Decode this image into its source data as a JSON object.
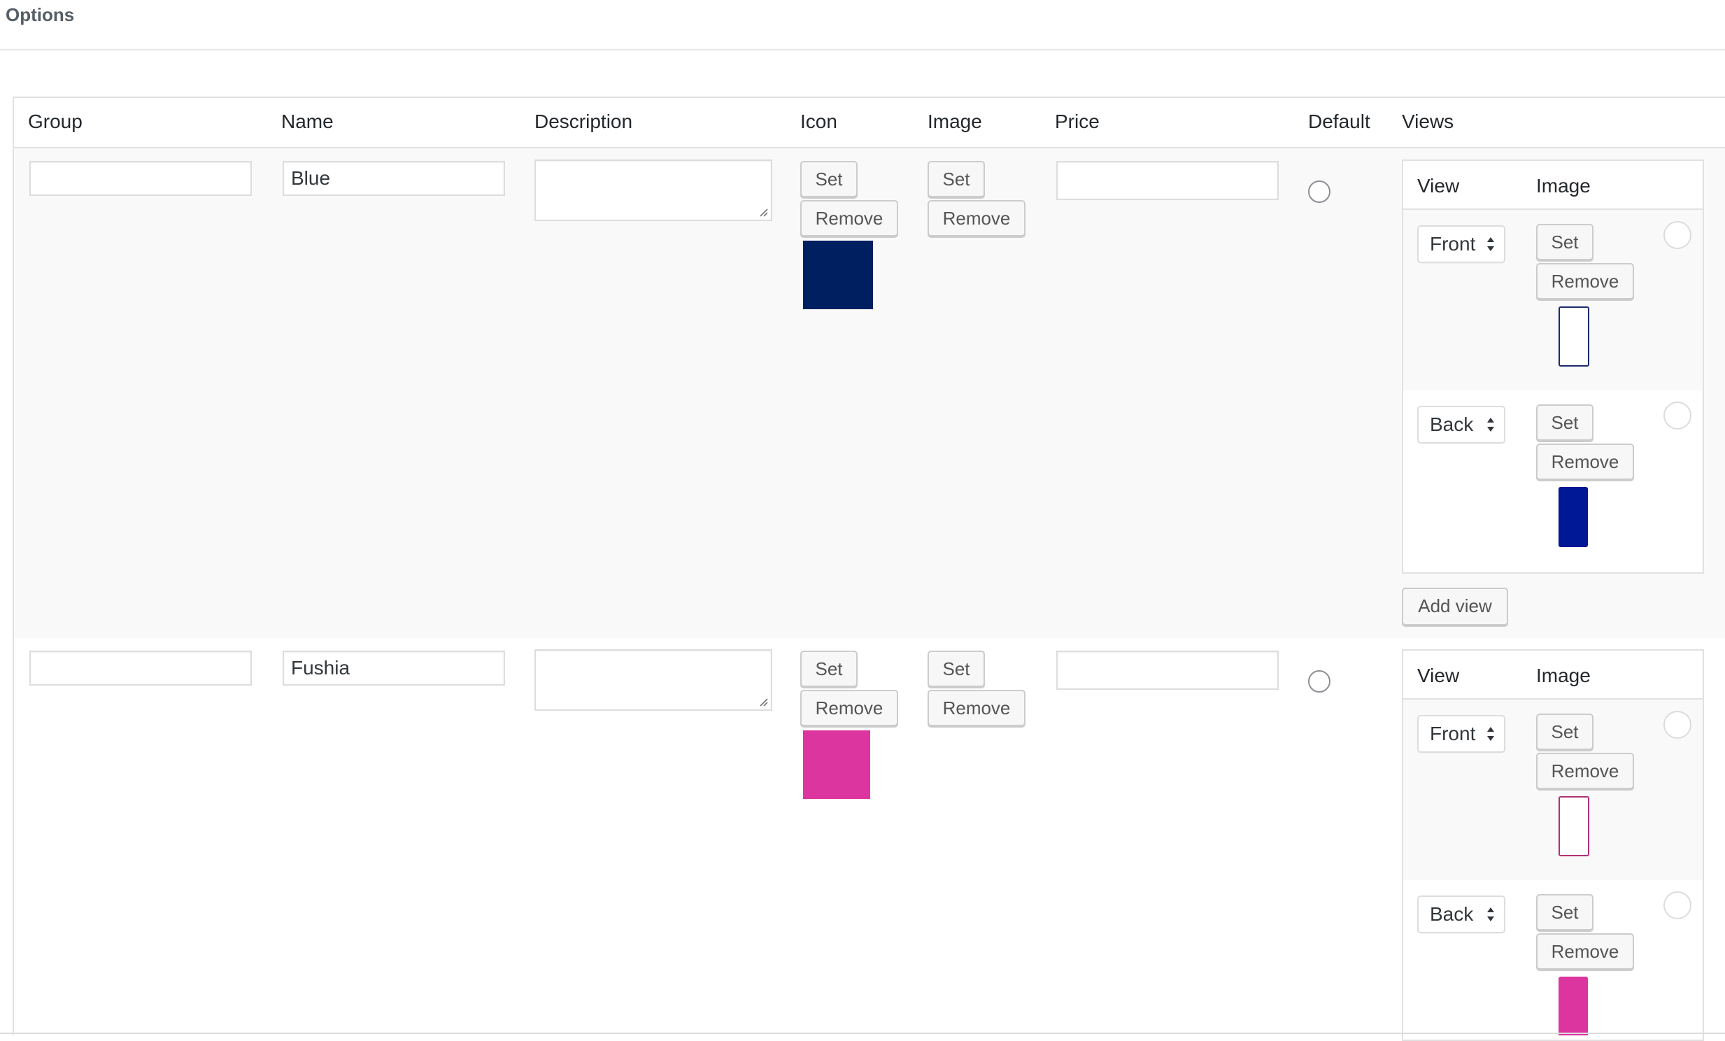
{
  "panel": {
    "title": "Options"
  },
  "table": {
    "columns": {
      "group": "Group",
      "name": "Name",
      "description": "Description",
      "icon": "Icon",
      "image": "Image",
      "price": "Price",
      "default": "Default",
      "views": "Views"
    }
  },
  "rows": [
    {
      "group": "",
      "name": "Blue",
      "description": "",
      "price": "",
      "icon_color": "#001f60",
      "buttons": {
        "set": "Set",
        "remove": "Remove"
      },
      "views_header": {
        "view": "View",
        "image": "Image"
      },
      "views": [
        {
          "view": "Front",
          "set": "Set",
          "remove": "Remove",
          "thumb_style": "outline",
          "thumb_color": "#1d2a6b"
        },
        {
          "view": "Back",
          "set": "Set",
          "remove": "Remove",
          "thumb_style": "solid",
          "thumb_color": "#001895"
        }
      ],
      "add_view": "Add view"
    },
    {
      "group": "",
      "name": "Fushia",
      "description": "",
      "price": "",
      "icon_color": "#dd35a0",
      "buttons": {
        "set": "Set",
        "remove": "Remove"
      },
      "views_header": {
        "view": "View",
        "image": "Image"
      },
      "views": [
        {
          "view": "Front",
          "set": "Set",
          "remove": "Remove",
          "thumb_style": "outline",
          "thumb_color": "#b0307c"
        },
        {
          "view": "Back",
          "set": "Set",
          "remove": "Remove",
          "thumb_style": "solid",
          "thumb_color": "#dd35a0"
        }
      ]
    }
  ]
}
